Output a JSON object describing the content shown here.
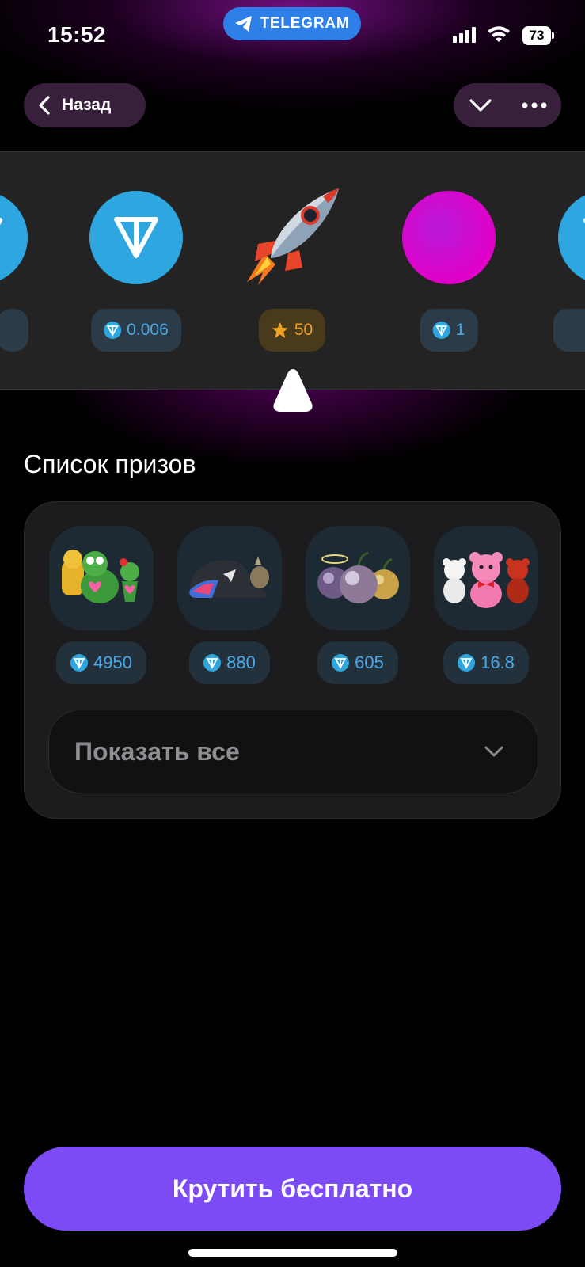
{
  "status_bar": {
    "time": "15:52",
    "app_badge": "TELEGRAM",
    "battery": "73"
  },
  "nav": {
    "back_label": "Назад",
    "collapse_icon": "chevron-down-icon",
    "more_icon": "more-icon"
  },
  "roulette": {
    "items": [
      {
        "kind": "ton",
        "price": ""
      },
      {
        "kind": "ton",
        "price": "0.006",
        "currency": "ton"
      },
      {
        "kind": "rocket",
        "price": "50",
        "currency": "star"
      },
      {
        "kind": "magenta-orb",
        "price": "1",
        "currency": "ton"
      },
      {
        "kind": "ton",
        "price": ""
      }
    ]
  },
  "prizes": {
    "title": "Список призов",
    "items": [
      {
        "name": "pepe-frogs",
        "price": "4950"
      },
      {
        "name": "durov-cap",
        "price": "880"
      },
      {
        "name": "plums",
        "price": "605"
      },
      {
        "name": "teddy-bears",
        "price": "16.8"
      }
    ],
    "show_all_label": "Показать все"
  },
  "cta": {
    "label": "Крутить бесплатно"
  },
  "colors": {
    "accent": "#7c4bf5",
    "ton": "#2ea6e0",
    "star": "#f0a322",
    "badge": "#2f7fe8"
  }
}
